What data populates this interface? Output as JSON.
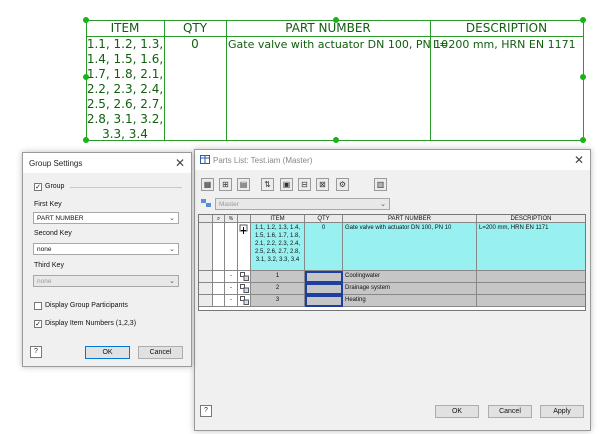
{
  "drawing": {
    "headers": {
      "item": "ITEM",
      "qty": "QTY",
      "part": "PART NUMBER",
      "desc": "DESCRIPTION"
    },
    "row": {
      "item_lines": [
        "1.1, 1.2, 1.3,",
        "1.4, 1.5, 1.6,",
        "1.7, 1.8, 2.1,",
        "2.2, 2.3, 2.4,",
        "2.5, 2.6, 2.7,",
        "2.8, 3.1, 3.2,",
        "3.3, 3.4"
      ],
      "qty": "0",
      "part": "Gate valve with actuator DN 100, PN 10",
      "desc": "L=200 mm, HRN EN 1171"
    }
  },
  "group_settings": {
    "title": "Group Settings",
    "group_label": "Group",
    "first_key_label": "First Key",
    "first_key_value": "PART NUMBER",
    "second_key_label": "Second Key",
    "second_key_value": "none",
    "third_key_label": "Third Key",
    "third_key_value": "none",
    "display_participants_label": "Display Group Participants",
    "display_item_numbers_label": "Display Item Numbers (1,2,3)",
    "ok": "OK",
    "cancel": "Cancel",
    "help": "?"
  },
  "parts_list": {
    "title": "Parts List: Test.iam (Master)",
    "view_value": "Master",
    "columns": {
      "item": "ITEM",
      "qty": "QTY",
      "part": "PART NUMBER",
      "desc": "DESCRIPTION"
    },
    "main_row": {
      "item_lines": [
        "1.1, 1.2, 1.3, 1.4,",
        "1.5, 1.6, 1.7, 1.8,",
        "2.1, 2.2, 2.3, 2.4,",
        "2.5, 2.6, 2.7, 2.8,",
        "3.1, 3.2, 3.3, 3.4"
      ],
      "qty": "0",
      "part": "Gate valve with actuator DN 100, PN 10",
      "desc": "L=200 mm, HRN EN 1171"
    },
    "sub_rows": [
      {
        "item": "1",
        "part": "Coolingwater"
      },
      {
        "item": "2",
        "part": "Drainage system"
      },
      {
        "item": "3",
        "part": "Heating"
      }
    ],
    "expand_minus": "-",
    "expand_plus": "+",
    "ok": "OK",
    "cancel": "Cancel",
    "apply": "Apply",
    "help": "?"
  }
}
